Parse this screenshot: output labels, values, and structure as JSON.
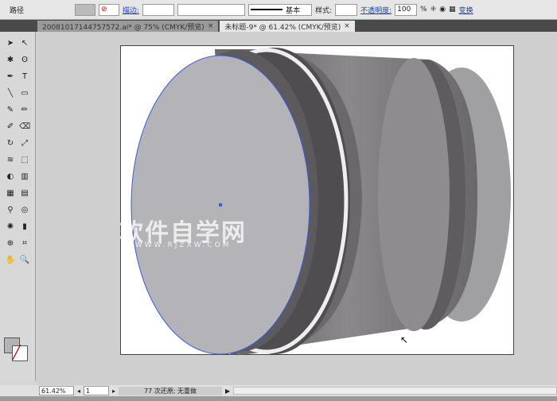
{
  "control_bar": {
    "selection_type": "路径",
    "stroke_label": "描边:",
    "stroke_profile": "基本",
    "style_label": "样式:",
    "opacity_label": "不透明度:",
    "opacity_value": "100",
    "opacity_unit": "%",
    "transform_label": "变换"
  },
  "tabs": [
    {
      "label": "20081017144757572.ai* @ 75% (CMYK/预览)",
      "active": false
    },
    {
      "label": "未标题-9* @ 61.42% (CMYK/预览)",
      "active": true
    }
  ],
  "watermark": {
    "line1": "软件自学网",
    "line2": "WWW.RJZXW.COM"
  },
  "status": {
    "zoom": "61.42%",
    "page": "1",
    "message": "77 次还原; 无重做"
  },
  "colors": {
    "fill": "#b4b4b8",
    "artboard": "#ffffff",
    "selection": "#3b5bdb"
  }
}
